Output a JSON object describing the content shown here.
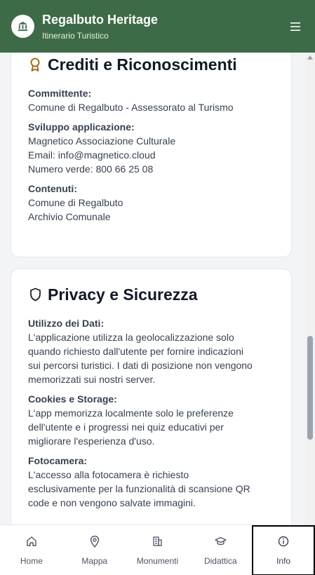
{
  "header": {
    "title": "Regalbuto Heritage",
    "subtitle": "Itinerario Turistico",
    "logo_icon": "museum-icon",
    "menu_icon": "hamburger-menu-icon"
  },
  "credits": {
    "icon": "award-icon",
    "title": "Crediti e Riconoscimenti",
    "sections": [
      {
        "label": "Committente:",
        "lines": [
          "Comune di Regalbuto - Assessorato al Turismo"
        ]
      },
      {
        "label": "Sviluppo applicazione:",
        "lines": [
          "Magnetico Associazione Culturale",
          "Email: info@magnetico.cloud",
          "Numero verde: 800 66 25 08"
        ]
      },
      {
        "label": "Contenuti:",
        "lines": [
          "Comune di Regalbuto",
          "Archivio Comunale"
        ]
      }
    ]
  },
  "privacy": {
    "icon": "shield-icon",
    "title": "Privacy e Sicurezza",
    "sections": [
      {
        "label": "Utilizzo dei Dati:",
        "lines": [
          "L'applicazione utilizza la geolocalizzazione solo",
          "quando richiesto dall'utente per fornire indicazioni",
          "sui percorsi turistici. I dati di posizione non vengono",
          "memorizzati sui nostri server."
        ]
      },
      {
        "label": "Cookies e Storage:",
        "lines": [
          "L'app memorizza localmente solo le preferenze",
          "dell'utente e i progressi nei quiz educativi per",
          "migliorare l'esperienza d'uso."
        ]
      },
      {
        "label": "Fotocamera:",
        "lines": [
          "L'accesso alla fotocamera è richiesto",
          "esclusivamente per la funzionalità di scansione QR",
          "code e non vengono salvate immagini."
        ]
      }
    ]
  },
  "nav": {
    "items": [
      {
        "label": "Home",
        "icon": "home-icon"
      },
      {
        "label": "Mappa",
        "icon": "map-pin-icon"
      },
      {
        "label": "Monumenti",
        "icon": "building-icon"
      },
      {
        "label": "Didattica",
        "icon": "graduation-cap-icon"
      },
      {
        "label": "Info",
        "icon": "info-icon",
        "active": true
      }
    ]
  },
  "colors": {
    "header_bg": "#3d6b47",
    "accent_gold": "#a16207"
  }
}
